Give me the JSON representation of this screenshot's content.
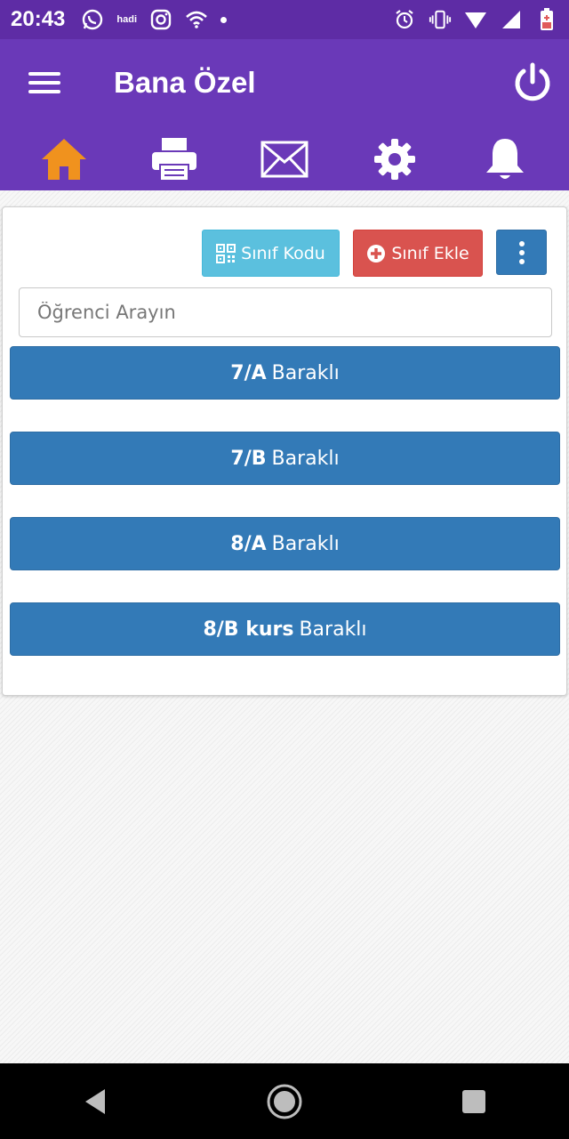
{
  "status_bar": {
    "time": "20:43",
    "carrier_text": "hadi",
    "icons": [
      "whatsapp-icon",
      "hadi-icon",
      "instagram-icon",
      "wifi-icon",
      "dot-icon",
      "alarm-icon",
      "vibrate-icon",
      "signal-icon",
      "battery-icon"
    ]
  },
  "app_bar": {
    "title": "Bana Özel",
    "menu_icon": "hamburger-menu-icon",
    "power_icon": "power-icon"
  },
  "tabs": [
    {
      "icon": "home-icon",
      "active": true
    },
    {
      "icon": "printer-icon",
      "active": false
    },
    {
      "icon": "mail-icon",
      "active": false
    },
    {
      "icon": "gear-icon",
      "active": false
    },
    {
      "icon": "bell-icon",
      "active": false
    }
  ],
  "toolbar": {
    "class_code_label": "Sınıf Kodu",
    "add_class_label": "Sınıf Ekle"
  },
  "search": {
    "placeholder": "Öğrenci Arayın"
  },
  "classes": [
    {
      "name": "7/A",
      "school": "Baraklı"
    },
    {
      "name": "7/B",
      "school": "Baraklı"
    },
    {
      "name": "8/A",
      "school": "Baraklı"
    },
    {
      "name": "8/B kurs",
      "school": "Baraklı"
    }
  ],
  "colors": {
    "status_bar": "#5e2ca5",
    "app_bar": "#6a39b8",
    "active_tab": "#f0921e",
    "info_button": "#5bc0de",
    "danger_button": "#d9534f",
    "primary_button": "#337ab7"
  }
}
